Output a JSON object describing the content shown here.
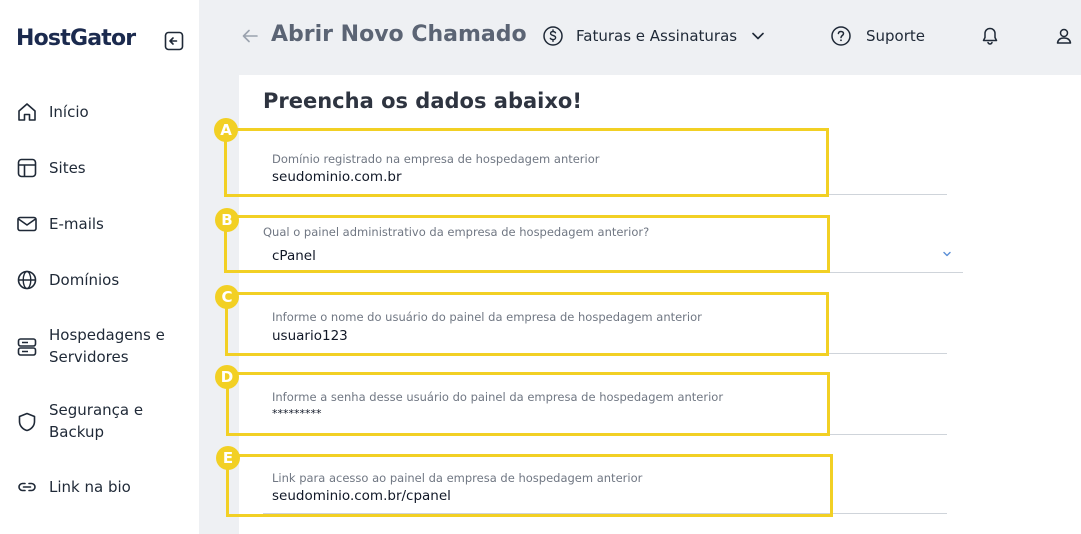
{
  "brand": {
    "logo_text": "HostGator"
  },
  "sidebar": {
    "items": [
      {
        "label": "Início",
        "icon": "home-icon"
      },
      {
        "label": "Sites",
        "icon": "layout-icon"
      },
      {
        "label": "E-mails",
        "icon": "mail-icon"
      },
      {
        "label": "Domínios",
        "icon": "globe-icon"
      },
      {
        "label": "Hospedagens e Servidores",
        "icon": "server-icon"
      },
      {
        "label": "Segurança e Backup",
        "icon": "shield-icon"
      },
      {
        "label": "Link na bio",
        "icon": "link-icon"
      }
    ]
  },
  "header": {
    "title": "Abrir Novo Chamado",
    "billing_label": "Faturas e Assinaturas",
    "support_label": "Suporte"
  },
  "form": {
    "title": "Preencha os dados abaixo!",
    "fields": [
      {
        "badge": "A",
        "label": "Domínio registrado na empresa de hospedagem anterior",
        "value": "seudominio.com.br"
      },
      {
        "badge": "B",
        "label": "Qual o painel administrativo da empresa de hospedagem anterior?",
        "value": "cPanel"
      },
      {
        "badge": "C",
        "label": "Informe o nome do usuário do painel da empresa de hospedagem anterior",
        "value": "usuario123"
      },
      {
        "badge": "D",
        "label": "Informe a senha desse usuário do painel da empresa de hospedagem anterior",
        "value": "*********"
      },
      {
        "badge": "E",
        "label": "Link para acesso ao painel da empresa de hospedagem anterior",
        "value": "seudominio.com.br/cpanel"
      }
    ]
  },
  "colors": {
    "highlight": "#f2d024",
    "brand_navy": "#1b2a4e"
  }
}
